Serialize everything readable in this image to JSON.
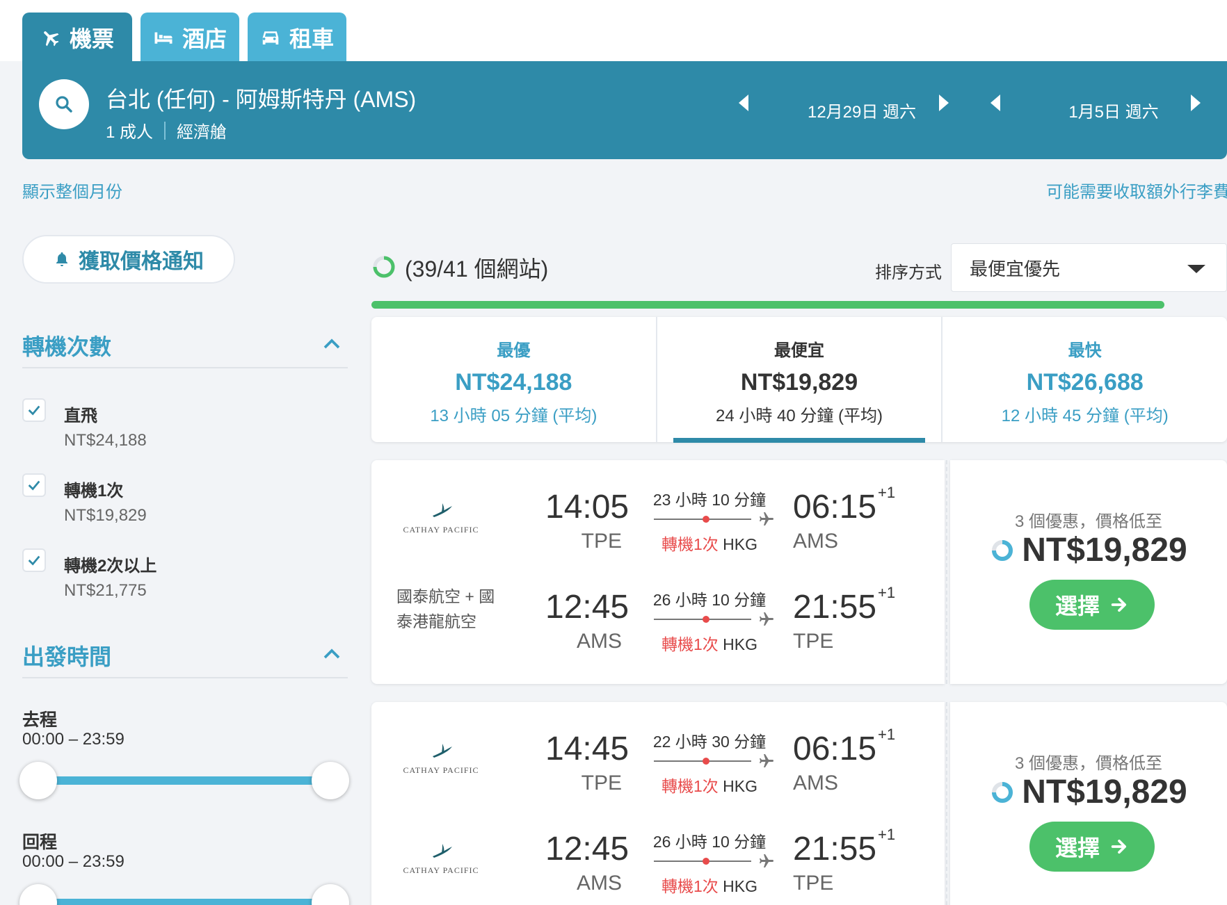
{
  "tabs": [
    {
      "label": "機票"
    },
    {
      "label": "酒店"
    },
    {
      "label": "租車"
    }
  ],
  "search": {
    "route": "台北 (任何) - 阿姆斯特丹 (AMS)",
    "passengers": "1 成人",
    "cabin": "經濟艙",
    "depart_date": "12月29日 週六",
    "return_date": "1月5日 週六"
  },
  "links": {
    "show_month": "顯示整個月份",
    "baggage_fee": "可能需要收取額外行李費"
  },
  "alert_button": "獲取價格通知",
  "filters": {
    "stops_title": "轉機次數",
    "stops": [
      {
        "label": "直飛",
        "price": "NT$24,188",
        "checked": true
      },
      {
        "label": "轉機1次",
        "price": "NT$19,829",
        "checked": true
      },
      {
        "label": "轉機2次以上",
        "price": "NT$21,775",
        "checked": true
      }
    ],
    "time_title": "出發時間",
    "outbound_label": "去程",
    "outbound_range": "00:00 – 23:59",
    "return_label": "回程",
    "return_range": "00:00 – 23:59"
  },
  "progress": {
    "text": "(39/41 個網站)",
    "value": 0.95
  },
  "sort": {
    "label": "排序方式",
    "selected": "最便宜優先"
  },
  "summary": [
    {
      "label": "最優",
      "price": "NT$24,188",
      "duration": "13 小時 05 分鐘 (平均)"
    },
    {
      "label": "最便宜",
      "price": "NT$19,829",
      "duration": "24 小時 40 分鐘 (平均)"
    },
    {
      "label": "最快",
      "price": "NT$26,688",
      "duration": "12 小時 45 分鐘 (平均)"
    }
  ],
  "results": [
    {
      "airline_logo": "CATHAY PACIFIC",
      "airline_name": "國泰航空 + 國泰港龍航空",
      "outbound": {
        "dep_time": "14:05",
        "dep_code": "TPE",
        "duration": "23 小時 10 分鐘",
        "stops": "轉機1次",
        "via": "HKG",
        "arr_time": "06:15",
        "arr_code": "AMS",
        "day_offset": "+1"
      },
      "inbound": {
        "dep_time": "12:45",
        "dep_code": "AMS",
        "duration": "26 小時 10 分鐘",
        "stops": "轉機1次",
        "via": "HKG",
        "arr_time": "21:55",
        "arr_code": "TPE",
        "day_offset": "+1"
      },
      "deals": "3 個優惠，價格低至",
      "price": "NT$19,829",
      "button": "選擇"
    },
    {
      "airline_logo": "CATHAY PACIFIC",
      "outbound": {
        "dep_time": "14:45",
        "dep_code": "TPE",
        "duration": "22 小時 30 分鐘",
        "stops": "轉機1次",
        "via": "HKG",
        "arr_time": "06:15",
        "arr_code": "AMS",
        "day_offset": "+1"
      },
      "inbound": {
        "dep_time": "12:45",
        "dep_code": "AMS",
        "duration": "26 小時 10 分鐘",
        "stops": "轉機1次",
        "via": "HKG",
        "arr_time": "21:55",
        "arr_code": "TPE",
        "day_offset": "+1"
      },
      "deals": "3 個優惠，價格低至",
      "price": "NT$19,829",
      "button": "選擇"
    }
  ],
  "colors": {
    "primary": "#2e8aa8",
    "tab": "#4bb3d6",
    "link": "#3a9ec4",
    "green": "#4cc16a",
    "stop_red": "#e84b4b"
  }
}
